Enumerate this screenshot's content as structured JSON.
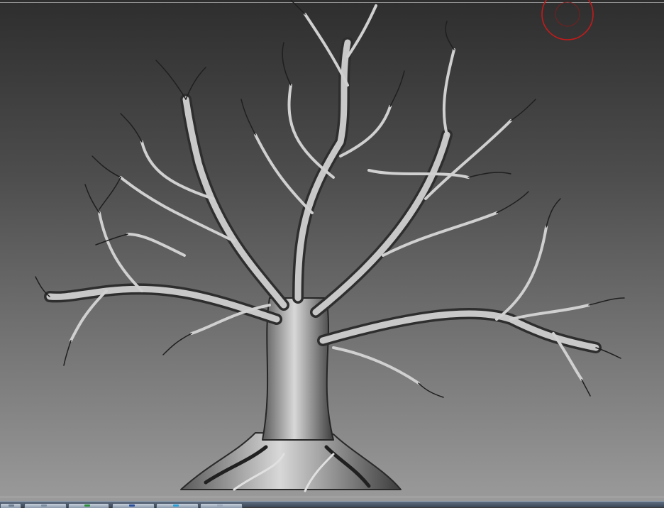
{
  "viewport": {
    "background_top": "#2e2e2e",
    "background_bottom": "#9a9a9a",
    "model": "tree-mesh",
    "model_color": "#bdbdbd",
    "gizmo_color": "#c41a1a"
  },
  "taskbar": {
    "buttons": [
      {
        "icon": "app-icon",
        "accent": "#6c7b8f"
      },
      {
        "icon": "app-icon",
        "accent": "#7d8ea3"
      },
      {
        "icon": "app-icon",
        "accent": "#2f8f3f"
      },
      {
        "icon": "app-icon",
        "accent": "#2b4f9a"
      },
      {
        "icon": "app-icon",
        "accent": "#2a9fd6"
      },
      {
        "icon": "app-icon",
        "accent": "#9aa7b8"
      }
    ]
  }
}
